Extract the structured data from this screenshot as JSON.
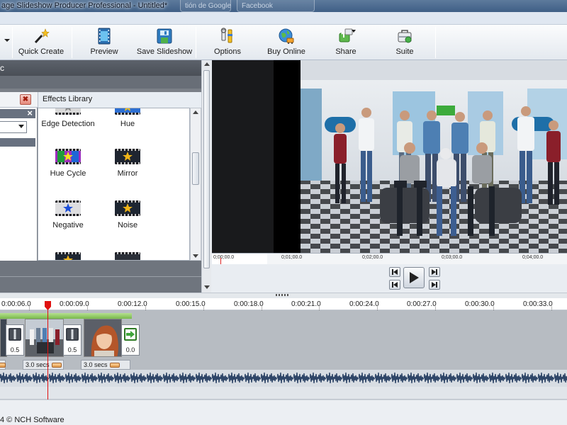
{
  "window": {
    "title": "age Slideshow Producer Professional - Untitled*",
    "ghost_tabs": [
      "tión de Google",
      "Facebook"
    ]
  },
  "toolbar": {
    "buttons": [
      {
        "label": "Quick Create",
        "icon": "magic-wand-icon"
      },
      {
        "label": "Preview",
        "icon": "film-preview-icon"
      },
      {
        "label": "Save Slideshow",
        "icon": "save-slideshow-icon"
      },
      {
        "label": "Options",
        "icon": "options-tools-icon"
      },
      {
        "label": "Buy Online",
        "icon": "globe-cart-icon"
      },
      {
        "label": "Share",
        "icon": "share-icon"
      },
      {
        "label": "Suite",
        "icon": "suite-icon"
      }
    ]
  },
  "left_panel": {
    "header_fragment": "c",
    "tab_label": "Effects Library",
    "effects": [
      {
        "label": "Edge Detection",
        "icon": "star-icon",
        "thumb_color": "#d9d9d9"
      },
      {
        "label": "Hue",
        "icon": "star-icon",
        "thumb_color": "#2d6fd3"
      },
      {
        "label": "Hue Cycle",
        "icon": "star-icon",
        "thumb_color": "#9f2bbf"
      },
      {
        "label": "Mirror",
        "icon": "star-icon",
        "thumb_color": "#1f2530"
      },
      {
        "label": "Negative",
        "icon": "star-icon",
        "thumb_color": "#dedee0"
      },
      {
        "label": "Noise",
        "icon": "star-icon",
        "thumb_color": "#1e2632"
      },
      {
        "label": "",
        "icon": "star-icon",
        "thumb_color": "#1e2632"
      },
      {
        "label": "",
        "icon": "star-icon",
        "thumb_color": "#2b2f38"
      }
    ]
  },
  "preview": {
    "ruler_labels": [
      "0;00;00.0",
      "0;01;00.0",
      "0;02;00.0",
      "0;03;00.0",
      "0;04;00.0"
    ],
    "controls": [
      "step-back",
      "play",
      "step-forward",
      "go-start",
      "go-end"
    ]
  },
  "timeline": {
    "ruler_labels": [
      "0:00:06.0",
      "0:00:09.0",
      "0:00:12.0",
      "0:00:15.0",
      "0:00:18.0",
      "0:00:21.0",
      "0:00:24.0",
      "0:00:27.0",
      "0:00:30.0",
      "0:00:33.0"
    ],
    "transitions": [
      "0.5",
      "0.5",
      "0.0"
    ],
    "clip_durations": [
      "3.0 secs",
      "3.0 secs"
    ]
  },
  "status": {
    "text": "4 © NCH Software"
  },
  "colors": {
    "accent_green": "#78b94b",
    "playhead_red": "#e01010",
    "panel_dark": "#7a7f87"
  }
}
